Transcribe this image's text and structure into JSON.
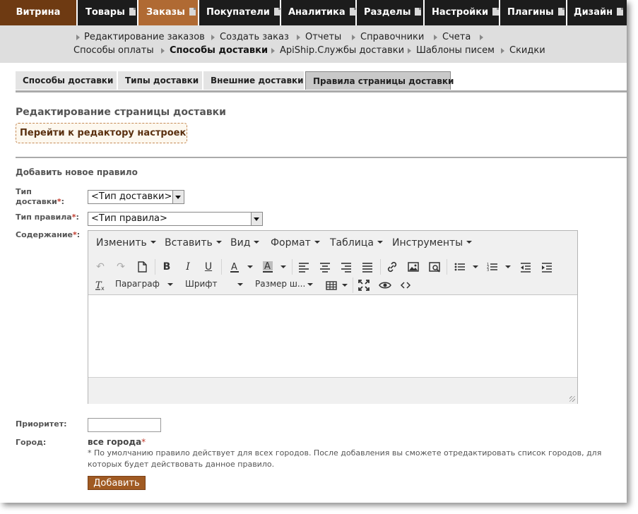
{
  "topnav": {
    "tabs": [
      {
        "label": "Витрина"
      },
      {
        "label": "Товары"
      },
      {
        "label": "Заказы"
      },
      {
        "label": "Покупатели"
      },
      {
        "label": "Аналитика"
      },
      {
        "label": "Разделы"
      },
      {
        "label": "Настройки"
      },
      {
        "label": "Плагины"
      },
      {
        "label": "Дизайн"
      }
    ],
    "active": "Заказы",
    "colors": {
      "bar": "#1c1c1c",
      "vitrina": "#6e3a12",
      "active": "#b06a33"
    }
  },
  "subnav": {
    "items": [
      {
        "label": "Редактирование заказов"
      },
      {
        "label": "Создать заказ"
      },
      {
        "label": "Отчеты"
      },
      {
        "label": "Справочники"
      },
      {
        "label": "Счета"
      },
      {
        "label": "Способы оплаты"
      },
      {
        "label": "Способы доставки"
      },
      {
        "label": "ApiShip.Службы доставки"
      },
      {
        "label": "Шаблоны писем"
      },
      {
        "label": "Скидки"
      }
    ],
    "active": "Способы доставки"
  },
  "subtabs": {
    "items": [
      {
        "label": "Способы доставки"
      },
      {
        "label": "Типы доставки"
      },
      {
        "label": "Внешние доставки"
      },
      {
        "label": "Правила страницы доставки"
      }
    ],
    "active": "Правила страницы доставки"
  },
  "page": {
    "title": "Редактирование страницы доставки",
    "editor_link": "Перейти к редактору настроек",
    "add_title": "Добавить новое правило"
  },
  "form": {
    "delivery_type_label_1": "Тип",
    "delivery_type_label_2": "доставки",
    "delivery_type_value": "<Тип доставки>",
    "rule_type_label": "Тип правила",
    "rule_type_value": "<Тип правила>",
    "content_label": "Содержание",
    "required_mark": "*",
    "colon": ":",
    "priority_label": "Приоритет:",
    "priority_value": "",
    "city_label": "Город:",
    "city_value": "все города",
    "city_note": "* По умолчанию правило действует для всех городов. После добавления вы сможете отредактировать список городов, для которых будет действовать данное правило.",
    "submit_label": "Добавить"
  },
  "editor": {
    "menus": [
      {
        "label": "Изменить"
      },
      {
        "label": "Вставить"
      },
      {
        "label": "Вид"
      },
      {
        "label": "Формат"
      },
      {
        "label": "Таблица"
      },
      {
        "label": "Инструменты"
      }
    ],
    "dropdowns": {
      "paragraph": "Параграф",
      "font": "Шрифт",
      "font_size": "Размер ш..."
    },
    "toolbar_icons": [
      "undo-icon",
      "redo-icon",
      "new-document-icon",
      "bold-icon",
      "italic-icon",
      "underline-icon",
      "text-color-icon",
      "background-color-icon",
      "align-left-icon",
      "align-center-icon",
      "align-right-icon",
      "justify-icon",
      "link-icon",
      "image-icon",
      "media-icon",
      "bullet-list-icon",
      "numbered-list-icon",
      "outdent-icon",
      "indent-icon",
      "clear-format-icon",
      "table-icon",
      "fullscreen-icon",
      "preview-icon",
      "code-icon"
    ],
    "content": ""
  }
}
